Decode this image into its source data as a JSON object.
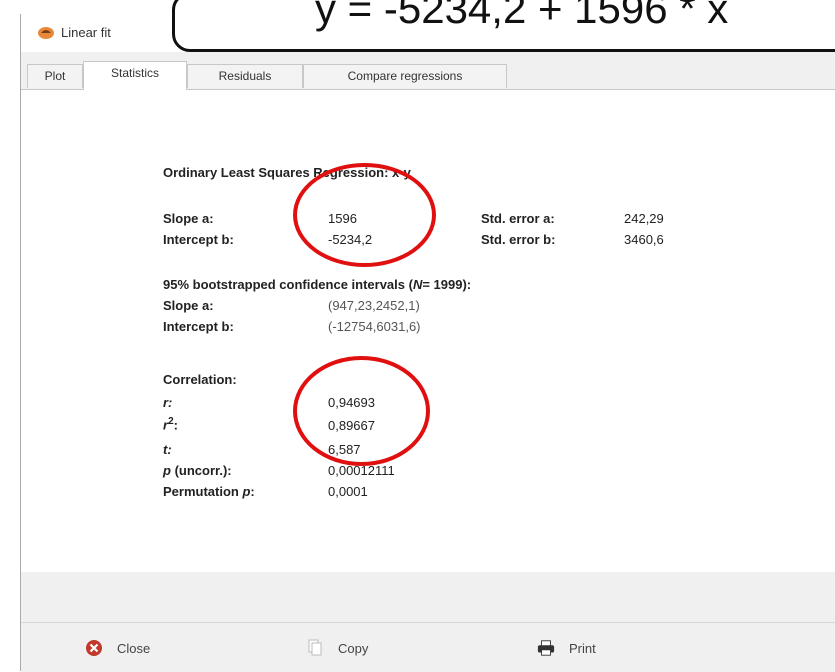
{
  "window": {
    "title": "Linear fit"
  },
  "callout": {
    "text": "y = -5234,2 + 1596 * x"
  },
  "tabs": [
    {
      "label": "Plot"
    },
    {
      "label": "Statistics"
    },
    {
      "label": "Residuals"
    },
    {
      "label": "Compare regressions"
    }
  ],
  "stats": {
    "heading": "Ordinary Least Squares Regression: x-y",
    "slope_label": "Slope a:",
    "slope_value": "1596",
    "std_error_a_label": "Std. error a:",
    "std_error_a_value": "242,29",
    "intercept_label": "Intercept b:",
    "intercept_value": "-5234,2",
    "std_error_b_label": "Std. error b:",
    "std_error_b_value": "3460,6",
    "ci_heading_pre": "95% bootstrapped confidence intervals (",
    "ci_heading_n": "N",
    "ci_heading_post": "= 1999):",
    "ci_slope_label": "Slope a:",
    "ci_slope_value": "(947,23,2452,1)",
    "ci_intercept_label": "Intercept b:",
    "ci_intercept_value": "(-12754,6031,6)",
    "corr_heading": "Correlation:",
    "r_label": "r:",
    "r_value": "0,94693",
    "r2_label": "r",
    "r2_sup": "2",
    "r2_colon": ":",
    "r2_value": "0,89667",
    "t_label": "t:",
    "t_value": "6,587",
    "p_label_italic": "p",
    "p_label_rest": " (uncorr.):",
    "p_value": "0,00012111",
    "perm_label_pre": "Permutation ",
    "perm_label_p": "p",
    "perm_label_post": ":",
    "perm_value": "0,0001"
  },
  "buttons": {
    "close": "Close",
    "copy": "Copy",
    "print": "Print"
  },
  "colors": {
    "highlight_circle": "#e01010",
    "close_icon": "#c0392b"
  }
}
